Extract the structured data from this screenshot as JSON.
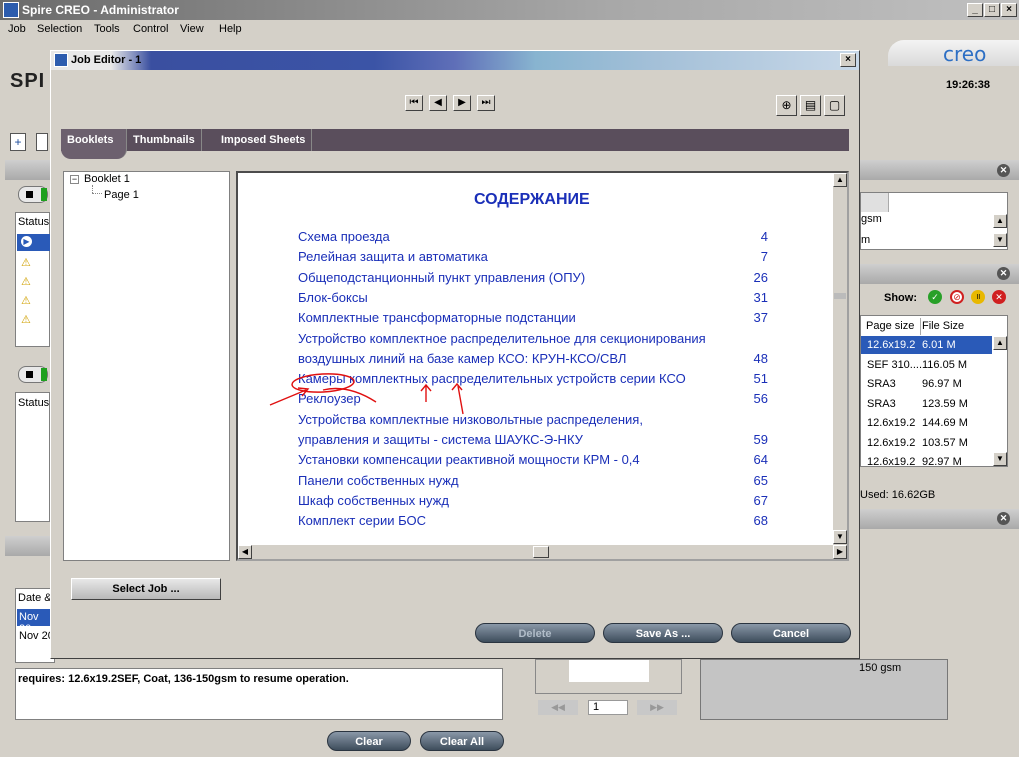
{
  "app": {
    "title": "Spire CREO - Administrator",
    "brand": "creo",
    "clock": "19:26:38",
    "logo_partial": "SPI"
  },
  "menu": [
    "Job",
    "Selection",
    "Tools",
    "Control",
    "View",
    "Help"
  ],
  "left_panel": {
    "status_header": "Status",
    "status_header2": "Status",
    "date_header": "Date &",
    "rows": [
      {
        "date": "Nov 20"
      },
      {
        "date": "Nov 20"
      }
    ],
    "message": "requires: 12.6x19.2SEF, Coat, 136-150gsm to resume operation."
  },
  "right_panel": {
    "paper_rows": [
      "gsm",
      "m"
    ],
    "show_label": "Show:",
    "columns": [
      "Page size",
      "File Size"
    ],
    "rows": [
      [
        "12.6x19.2",
        "6.01 M"
      ],
      [
        "SEF 310....",
        "116.05 M"
      ],
      [
        "SRA3",
        "96.97 M"
      ],
      [
        "SRA3",
        "123.59 M"
      ],
      [
        "12.6x19.2",
        "144.69 M"
      ],
      [
        "12.6x19.2",
        "103.57 M"
      ],
      [
        "12.6x19.2",
        "92.97 M"
      ]
    ],
    "used": "Used: 16.62GB",
    "bottom_text": "150 gsm",
    "page_input": "1"
  },
  "bottom_buttons": {
    "clear": "Clear",
    "clear_all": "Clear All"
  },
  "job_editor": {
    "title": "Job Editor - 1",
    "tabs": [
      "Booklets",
      "Thumbnails",
      "Imposed Sheets"
    ],
    "tree": {
      "root": "Booklet 1",
      "child": "Page 1"
    },
    "document": {
      "heading": "СОДЕРЖАНИЕ",
      "entries": [
        {
          "text": "Схема проезда",
          "page": "4"
        },
        {
          "text": "Релейная защита и автоматика",
          "page": "7"
        },
        {
          "text": "Общеподстанционный пункт управления (ОПУ)",
          "page": "26"
        },
        {
          "text": "Блок-боксы",
          "page": "31"
        },
        {
          "text": "Комплектные трансформаторные подстанции",
          "page": "37"
        },
        {
          "text": "Устройство комплектное распределительное для секционирования",
          "page": ""
        },
        {
          "text": "воздушных линий на базе камер КСО: КРУН-КСО/СВЛ",
          "page": "48"
        },
        {
          "text": "Камеры комплектных распределительных устройств серии КСО",
          "page": "51"
        },
        {
          "text": "Реклоузер",
          "page": "56"
        },
        {
          "text": "Устройства комплектные низковольтные распределения,",
          "page": ""
        },
        {
          "text": " управления и защиты - система ШАУКС-Э-НКУ",
          "page": "59"
        },
        {
          "text": "Установки компенсации реактивной мощности КРМ - 0,4",
          "page": "64"
        },
        {
          "text": "Панели собственных нужд",
          "page": "65"
        },
        {
          "text": "Шкаф собственных нужд",
          "page": "67"
        },
        {
          "text": "Комплект серии БОС",
          "page": "68"
        }
      ]
    },
    "buttons": {
      "select_job": "Select Job ...",
      "delete": "Delete",
      "save_as": "Save As ...",
      "cancel": "Cancel"
    }
  }
}
